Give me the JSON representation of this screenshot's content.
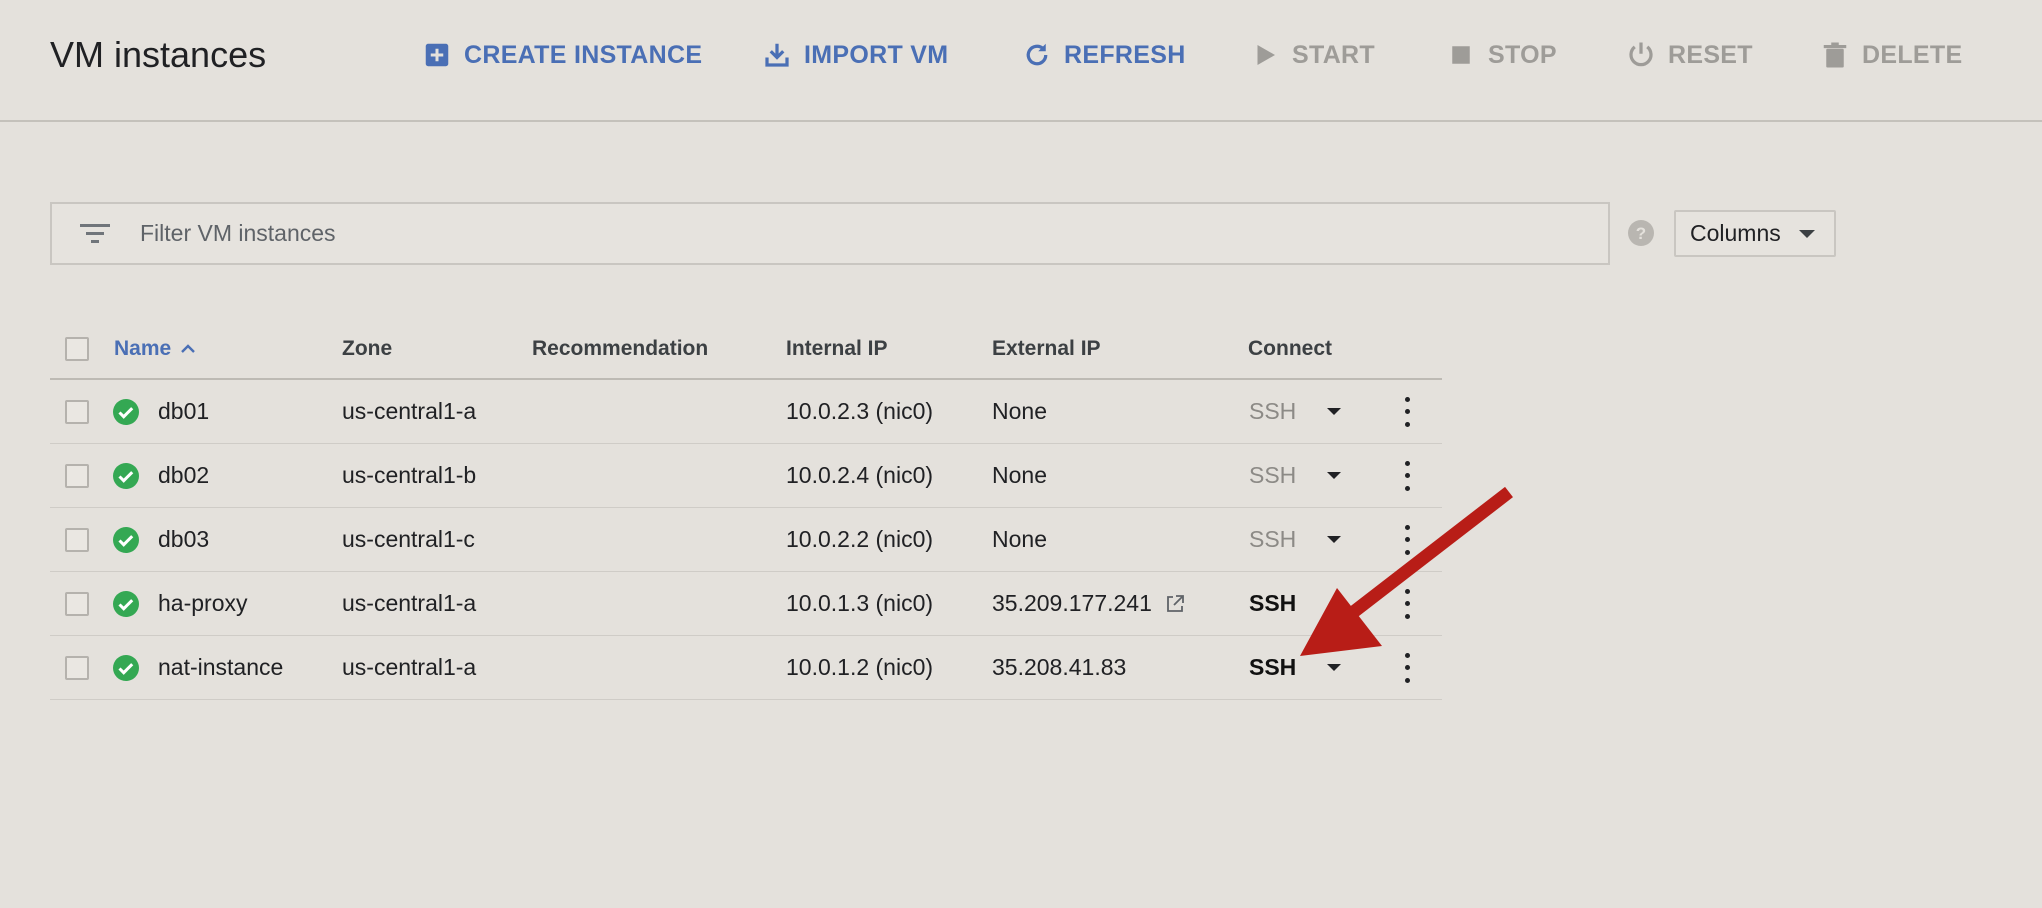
{
  "header": {
    "title": "VM instances",
    "actions": [
      {
        "label": "CREATE INSTANCE",
        "icon": "add-box-icon",
        "state": "active"
      },
      {
        "label": "IMPORT VM",
        "icon": "download-icon",
        "state": "active"
      },
      {
        "label": "REFRESH",
        "icon": "refresh-icon",
        "state": "active"
      },
      {
        "label": "START",
        "icon": "play-icon",
        "state": "disabled"
      },
      {
        "label": "STOP",
        "icon": "stop-icon",
        "state": "disabled"
      },
      {
        "label": "RESET",
        "icon": "power-icon",
        "state": "disabled"
      },
      {
        "label": "DELETE",
        "icon": "trash-icon",
        "state": "disabled"
      }
    ]
  },
  "filter": {
    "placeholder": "Filter VM instances"
  },
  "columns_button": {
    "label": "Columns"
  },
  "table": {
    "headers": {
      "name": "Name",
      "zone": "Zone",
      "recommendation": "Recommendation",
      "internal_ip": "Internal IP",
      "external_ip": "External IP",
      "connect": "Connect"
    },
    "rows": [
      {
        "name": "db01",
        "zone": "us-central1-a",
        "recommendation": "",
        "internal_ip": "10.0.2.3 (nic0)",
        "external_ip": "None",
        "connect": "SSH",
        "ssh_enabled": false
      },
      {
        "name": "db02",
        "zone": "us-central1-b",
        "recommendation": "",
        "internal_ip": "10.0.2.4 (nic0)",
        "external_ip": "None",
        "connect": "SSH",
        "ssh_enabled": false
      },
      {
        "name": "db03",
        "zone": "us-central1-c",
        "recommendation": "",
        "internal_ip": "10.0.2.2 (nic0)",
        "external_ip": "None",
        "connect": "SSH",
        "ssh_enabled": false
      },
      {
        "name": "ha-proxy",
        "zone": "us-central1-a",
        "recommendation": "",
        "internal_ip": "10.0.1.3 (nic0)",
        "external_ip": "35.209.177.241",
        "connect": "SSH",
        "ssh_enabled": true
      },
      {
        "name": "nat-instance",
        "zone": "us-central1-a",
        "recommendation": "",
        "internal_ip": "10.0.1.2 (nic0)",
        "external_ip": "35.208.41.83",
        "connect": "SSH",
        "ssh_enabled": true
      }
    ]
  },
  "colors": {
    "accent": "#4a6fb5",
    "status_ok": "#34a853",
    "annotation_arrow": "#b81d17",
    "disabled": "#9e9c98"
  }
}
